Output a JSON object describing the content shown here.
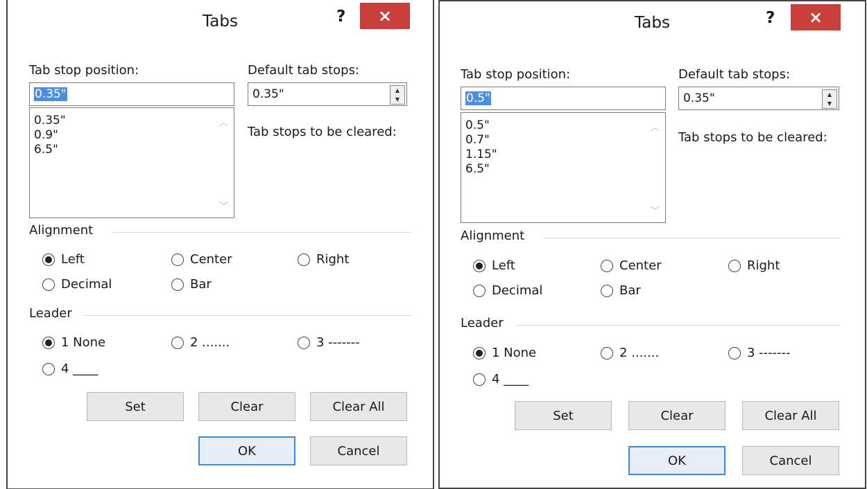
{
  "dialogs": [
    {
      "title": "Tabs",
      "help": "?",
      "close": "×",
      "tab_stop_label": "Tab stop position:",
      "tab_stop_value": "0.35\"",
      "tab_stop_list": [
        "0.35\"",
        "0.9\"",
        "6.5\""
      ],
      "default_label": "Default tab stops:",
      "default_value": "0.35\"",
      "cleared_label": "Tab stops to be cleared:",
      "alignment_label": "Alignment",
      "alignment": {
        "left": "Left",
        "center": "Center",
        "right": "Right",
        "decimal": "Decimal",
        "bar": "Bar",
        "selected": "left"
      },
      "leader_label": "Leader",
      "leader": {
        "l1": "1 None",
        "l2": "2 .......",
        "l3": "3 -------",
        "l4": "4 ____",
        "selected": "l1"
      },
      "buttons": {
        "set": "Set",
        "clear": "Clear",
        "clear_all": "Clear All",
        "ok": "OK",
        "cancel": "Cancel"
      }
    },
    {
      "title": "Tabs",
      "help": "?",
      "close": "×",
      "tab_stop_label": "Tab stop position:",
      "tab_stop_value": "0.5\"",
      "tab_stop_list": [
        "0.5\"",
        "0.7\"",
        "1.15\"",
        "6.5\""
      ],
      "default_label": "Default tab stops:",
      "default_value": "0.35\"",
      "cleared_label": "Tab stops to be cleared:",
      "alignment_label": "Alignment",
      "alignment": {
        "left": "Left",
        "center": "Center",
        "right": "Right",
        "decimal": "Decimal",
        "bar": "Bar",
        "selected": "left"
      },
      "leader_label": "Leader",
      "leader": {
        "l1": "1 None",
        "l2": "2 .......",
        "l3": "3 -------",
        "l4": "4 ____",
        "selected": "l1"
      },
      "buttons": {
        "set": "Set",
        "clear": "Clear",
        "clear_all": "Clear All",
        "ok": "OK",
        "cancel": "Cancel"
      }
    }
  ]
}
